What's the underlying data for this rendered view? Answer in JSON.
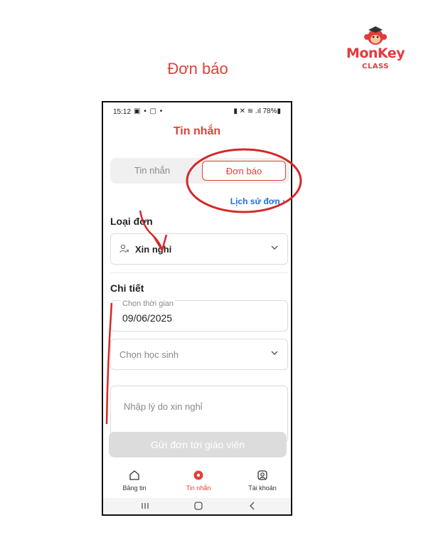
{
  "slide": {
    "title": "Đơn báo"
  },
  "brand": {
    "name": "MonKey",
    "sub": "CLASS"
  },
  "status_bar": {
    "time": "15:12",
    "left_icons": "▣ ▪ ▢ •",
    "right_icons": "▮ ✕ ≋ .ıl 78%▮"
  },
  "app": {
    "title": "Tin nhắn"
  },
  "segment": {
    "left": "Tin nhắn",
    "right": "Đơn báo"
  },
  "history_link": "Lịch sử đơn  ›",
  "form": {
    "type_label": "Loại đơn",
    "type_value": "Xin nghỉ",
    "detail_label": "Chi tiết",
    "date_label": "Chọn thời gian",
    "date_value": "09/06/2025",
    "student_placeholder": "Chọn học sinh",
    "reason_placeholder": "Nhập lý do xin nghỉ",
    "submit": "Gửi đơn tới giáo viên"
  },
  "tabs": [
    {
      "label": "Bảng tin",
      "icon": "home-icon"
    },
    {
      "label": "Tin nhắn",
      "icon": "chat-icon"
    },
    {
      "label": "Tài khoản",
      "icon": "account-icon"
    }
  ],
  "colors": {
    "accent": "#e0413a",
    "link": "#1f6fd6",
    "annotation": "#d4282a"
  }
}
